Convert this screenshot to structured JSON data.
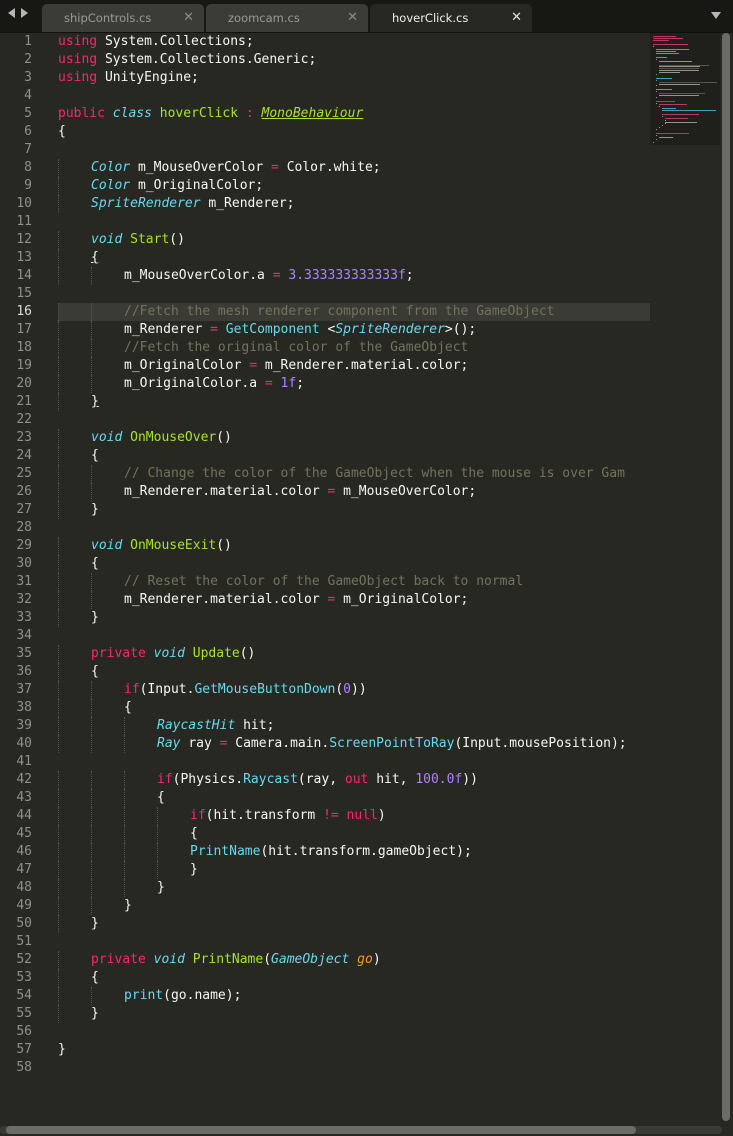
{
  "tabs": [
    {
      "label": "shipControls.cs",
      "close": "✕",
      "active": false
    },
    {
      "label": "zoomcam.cs",
      "close": "✕",
      "active": false
    },
    {
      "label": "hoverClick.cs",
      "close": "✕",
      "active": true
    }
  ],
  "current_line": 16,
  "lines": [
    [
      [
        "kw",
        "using"
      ],
      [
        "",
        "System.Collections;"
      ]
    ],
    [
      [
        "kw",
        "using"
      ],
      [
        "",
        "System.Collections.Generic;"
      ]
    ],
    [
      [
        "kw",
        "using"
      ],
      [
        "",
        "UnityEngine;"
      ]
    ],
    [],
    [
      [
        "kw",
        "public"
      ],
      [
        "",
        ""
      ],
      [
        "ty",
        "class"
      ],
      [
        "",
        ""
      ],
      [
        "cls",
        "hoverClick"
      ],
      [
        "",
        ""
      ],
      [
        "kw",
        ":"
      ],
      [
        "",
        ""
      ],
      [
        "inh",
        "MonoBehaviour"
      ]
    ],
    [
      [
        "",
        "{"
      ]
    ],
    [],
    [
      [
        "",
        ""
      ],
      [
        "ty",
        "Color"
      ],
      [
        "",
        "m_MouseOverColor"
      ],
      [
        "kw",
        "="
      ],
      [
        "",
        "Color.white;"
      ]
    ],
    [
      [
        "",
        ""
      ],
      [
        "ty",
        "Color"
      ],
      [
        "",
        "m_OriginalColor;"
      ]
    ],
    [
      [
        "",
        ""
      ],
      [
        "ty",
        "SpriteRenderer"
      ],
      [
        "",
        "m_Renderer;"
      ]
    ],
    [],
    [
      [
        "",
        ""
      ],
      [
        "ty",
        "void"
      ],
      [
        "",
        ""
      ],
      [
        "fnd",
        "Start"
      ],
      [
        "",
        "()"
      ]
    ],
    [
      [
        "",
        ""
      ],
      [
        "br-match",
        "{"
      ]
    ],
    [
      [
        "",
        ""
      ],
      [
        "",
        "m_MouseOverColor.a"
      ],
      [
        "kw",
        "="
      ],
      [
        "",
        ""
      ],
      [
        "num",
        "3.333333333333f"
      ],
      [
        "",
        ";"
      ]
    ],
    [],
    [
      [
        "",
        ""
      ],
      [
        "cm",
        "//Fetch the mesh renderer component from the GameObject"
      ]
    ],
    [
      [
        "",
        "m_Renderer"
      ],
      [
        "kw",
        "="
      ],
      [
        "",
        ""
      ],
      [
        "fn",
        "GetComponent"
      ],
      [
        "",
        "<"
      ],
      [
        "ty",
        "SpriteRenderer"
      ],
      [
        "",
        ">();"
      ]
    ],
    [
      [
        "",
        ""
      ],
      [
        "cm",
        "//Fetch the original color of the GameObject"
      ]
    ],
    [
      [
        "",
        "m_OriginalColor"
      ],
      [
        "kw",
        "="
      ],
      [
        "",
        "m_Renderer.material.color;"
      ]
    ],
    [
      [
        "",
        "m_OriginalColor.a"
      ],
      [
        "kw",
        "="
      ],
      [
        "",
        ""
      ],
      [
        "num",
        "1f"
      ],
      [
        "",
        ";"
      ]
    ],
    [
      [
        "",
        ""
      ],
      [
        "br-match",
        "}"
      ]
    ],
    [],
    [
      [
        "",
        ""
      ],
      [
        "ty",
        "void"
      ],
      [
        "",
        ""
      ],
      [
        "fnd",
        "OnMouseOver"
      ],
      [
        "",
        "()"
      ]
    ],
    [
      [
        "",
        "{"
      ]
    ],
    [
      [
        "",
        ""
      ],
      [
        "cm",
        "// Change the color of the GameObject when the mouse is over Gam"
      ]
    ],
    [
      [
        "",
        "m_Renderer.material.color"
      ],
      [
        "kw",
        "="
      ],
      [
        "",
        "m_MouseOverColor;"
      ]
    ],
    [
      [
        "",
        "}"
      ]
    ],
    [],
    [
      [
        "",
        ""
      ],
      [
        "ty",
        "void"
      ],
      [
        "",
        ""
      ],
      [
        "fnd",
        "OnMouseExit"
      ],
      [
        "",
        "()"
      ]
    ],
    [
      [
        "",
        "{"
      ]
    ],
    [
      [
        "",
        ""
      ],
      [
        "cm",
        "// Reset the color of the GameObject back to normal"
      ]
    ],
    [
      [
        "",
        "m_Renderer.material.color"
      ],
      [
        "kw",
        "="
      ],
      [
        "",
        "m_OriginalColor;"
      ]
    ],
    [
      [
        "",
        "}"
      ]
    ],
    [],
    [
      [
        "",
        ""
      ],
      [
        "kw",
        "private"
      ],
      [
        "",
        ""
      ],
      [
        "ty",
        "void"
      ],
      [
        "",
        ""
      ],
      [
        "fnd",
        "Update"
      ],
      [
        "",
        "()"
      ]
    ],
    [
      [
        "",
        "{"
      ]
    ],
    [
      [
        "",
        ""
      ],
      [
        "kw",
        "if"
      ],
      [
        "",
        "(Input."
      ],
      [
        "fn",
        "GetMouseButtonDown"
      ],
      [
        "",
        "("
      ],
      [
        "num",
        "0"
      ],
      [
        "",
        "))"
      ]
    ],
    [
      [
        "",
        "{"
      ]
    ],
    [
      [
        "",
        ""
      ],
      [
        "ty",
        "RaycastHit"
      ],
      [
        "",
        "hit;"
      ]
    ],
    [
      [
        "",
        ""
      ],
      [
        "ty",
        "Ray"
      ],
      [
        "",
        "ray"
      ],
      [
        "kw",
        "="
      ],
      [
        "",
        "Camera.main."
      ],
      [
        "fn",
        "ScreenPointToRay"
      ],
      [
        "",
        "(Input.mousePosition);"
      ]
    ],
    [],
    [
      [
        "",
        ""
      ],
      [
        "kw",
        "if"
      ],
      [
        "",
        "(Physics."
      ],
      [
        "fn",
        "Raycast"
      ],
      [
        "",
        "(ray,"
      ],
      [
        "kw",
        "out"
      ],
      [
        "",
        "hit,"
      ],
      [
        "num",
        "100.0f"
      ],
      [
        "",
        "))"
      ]
    ],
    [
      [
        "",
        "{"
      ]
    ],
    [
      [
        "",
        ""
      ],
      [
        "kw",
        "if"
      ],
      [
        "",
        "(hit.transform"
      ],
      [
        "kw",
        "!="
      ],
      [
        "",
        ""
      ],
      [
        "kw",
        "null"
      ],
      [
        "",
        ")"
      ]
    ],
    [
      [
        "",
        "{"
      ]
    ],
    [
      [
        "",
        ""
      ],
      [
        "fn",
        "PrintName"
      ],
      [
        "",
        "(hit.transform.gameObject);"
      ]
    ],
    [
      [
        "",
        "}"
      ]
    ],
    [
      [
        "",
        "}"
      ]
    ],
    [
      [
        "",
        "}"
      ]
    ],
    [
      [
        "",
        "}"
      ]
    ],
    [],
    [
      [
        "",
        ""
      ],
      [
        "kw",
        "private"
      ],
      [
        "",
        ""
      ],
      [
        "ty",
        "void"
      ],
      [
        "",
        ""
      ],
      [
        "fnd",
        "PrintName"
      ],
      [
        "",
        "("
      ],
      [
        "ty",
        "GameObject"
      ],
      [
        "",
        ""
      ],
      [
        "par",
        "go"
      ],
      [
        "",
        ")"
      ]
    ],
    [
      [
        "",
        "{"
      ]
    ],
    [
      [
        "",
        ""
      ],
      [
        "fn",
        "print"
      ],
      [
        "",
        "(go.name);"
      ]
    ],
    [
      [
        "",
        "}"
      ]
    ],
    [],
    [
      [
        "",
        "}"
      ]
    ],
    []
  ]
}
